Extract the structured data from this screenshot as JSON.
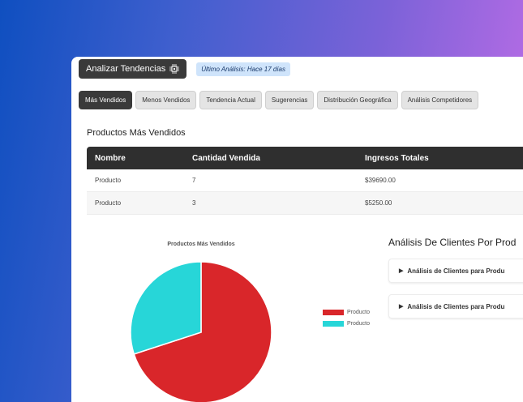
{
  "toolbar": {
    "analyze_label": "Analizar Tendencias",
    "last_analysis": "Último Análisis: Hace 17 días"
  },
  "tabs": [
    {
      "label": "Más Vendidos",
      "active": true
    },
    {
      "label": "Menos Vendidos",
      "active": false
    },
    {
      "label": "Tendencia Actual",
      "active": false
    },
    {
      "label": "Sugerencias",
      "active": false
    },
    {
      "label": "Distribución Geográfica",
      "active": false
    },
    {
      "label": "Análisis Competidores",
      "active": false
    }
  ],
  "products": {
    "title": "Productos Más Vendidos",
    "columns": [
      "Nombre",
      "Cantidad Vendida",
      "Ingresos Totales"
    ],
    "rows": [
      [
        "Producto",
        "7",
        "$39690.00"
      ],
      [
        "Producto",
        "3",
        "$5250.00"
      ]
    ]
  },
  "chart_data": {
    "type": "pie",
    "title": "Productos Más Vendidos",
    "labels": [
      "Producto",
      "Producto"
    ],
    "values": [
      7,
      3
    ],
    "colors": [
      "#d9262a",
      "#27d6d8"
    ],
    "legend": "right"
  },
  "analysis": {
    "title": "Análisis De Clientes Por Prod",
    "items": [
      "Análisis de Clientes para Produ",
      "Análisis de Clientes para Produ"
    ]
  }
}
